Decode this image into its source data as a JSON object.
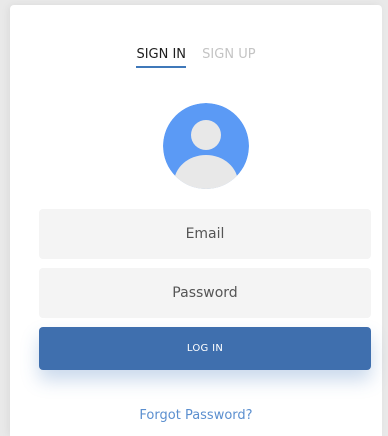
{
  "tabs": {
    "signin": "SIGN IN",
    "signup": "SIGN UP"
  },
  "avatar": {
    "icon": "user-avatar-icon",
    "color": "#5b9af5"
  },
  "form": {
    "email_placeholder": "Email",
    "password_placeholder": "Password",
    "login_label": "LOG IN",
    "forgot_label": "Forgot Password?"
  },
  "colors": {
    "accent": "#3f6fae",
    "link": "#5b8fcf",
    "field_bg": "#f4f4f4"
  }
}
